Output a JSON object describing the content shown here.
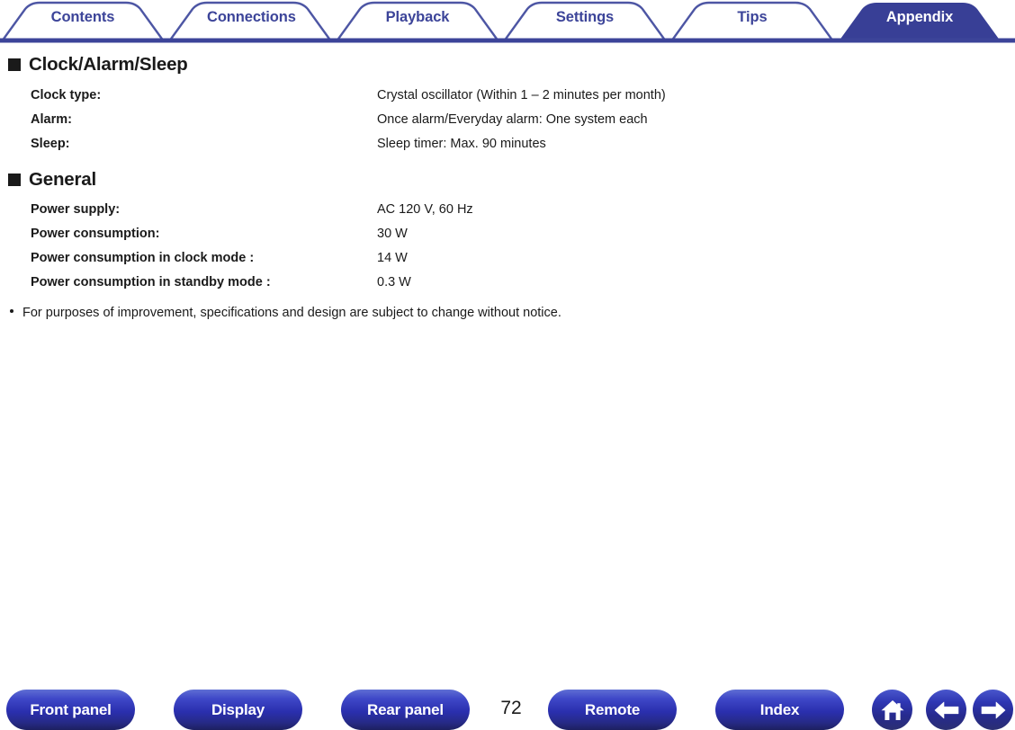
{
  "tabs": [
    {
      "label": "Contents",
      "active": false
    },
    {
      "label": "Connections",
      "active": false
    },
    {
      "label": "Playback",
      "active": false
    },
    {
      "label": "Settings",
      "active": false
    },
    {
      "label": "Tips",
      "active": false
    },
    {
      "label": "Appendix",
      "active": true
    }
  ],
  "sections": [
    {
      "title": "Clock/Alarm/Sleep",
      "rows": [
        {
          "label": "Clock type:",
          "value": "Crystal oscillator (Within 1 – 2 minutes per month)"
        },
        {
          "label": "Alarm:",
          "value": "Once alarm/Everyday alarm: One system each"
        },
        {
          "label": "Sleep:",
          "value": "Sleep timer: Max. 90 minutes"
        }
      ]
    },
    {
      "title": "General",
      "rows": [
        {
          "label": "Power supply:",
          "value": "AC 120 V, 60 Hz"
        },
        {
          "label": "Power consumption:",
          "value": "30 W"
        },
        {
          "label": "Power consumption in clock mode :",
          "value": "14 W"
        },
        {
          "label": "Power consumption in standby mode :",
          "value": "0.3 W"
        }
      ]
    }
  ],
  "note": "For purposes of improvement, specifications and design are subject to change without notice.",
  "footer": {
    "buttons": [
      {
        "label": "Front panel"
      },
      {
        "label": "Display"
      },
      {
        "label": "Rear panel"
      },
      {
        "label": "Remote"
      },
      {
        "label": "Index"
      }
    ],
    "page_number": "72",
    "icons": [
      {
        "name": "home-icon"
      },
      {
        "name": "arrow-left-icon"
      },
      {
        "name": "arrow-right-icon"
      }
    ]
  },
  "colors": {
    "tab_text": "#3c4499",
    "tab_active_bg": "#383f96",
    "rule": "#3c4499",
    "text": "#1a1a1a"
  }
}
